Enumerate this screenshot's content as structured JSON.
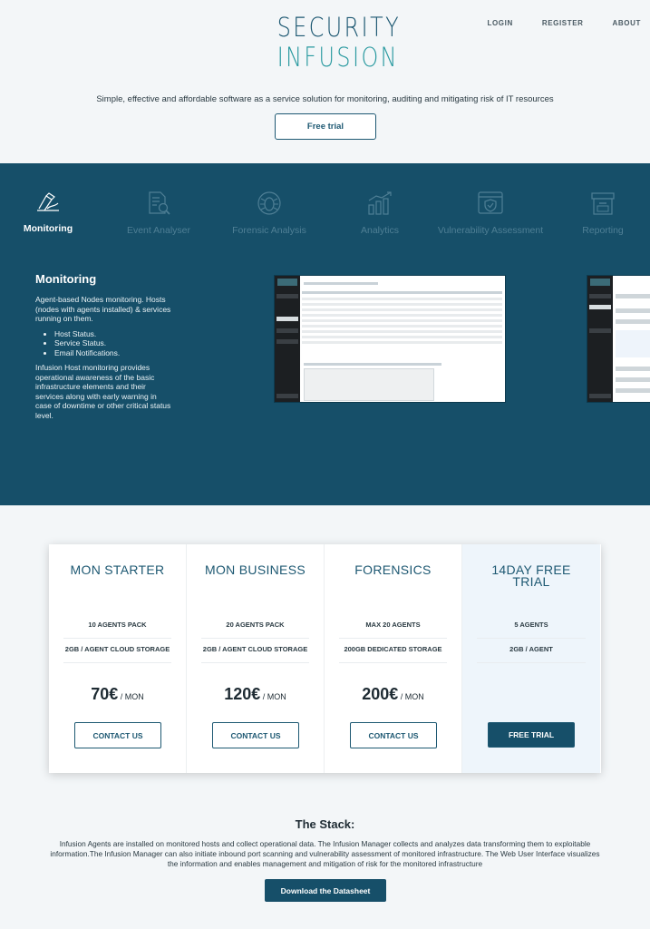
{
  "brand": {
    "line1": "SECURITY",
    "line2": "INFUSION",
    "color_dark": "#1d5872",
    "color_teal": "#2a9aa0"
  },
  "nav": {
    "login": "LOGIN",
    "register": "REGISTER",
    "about": "ABOUT"
  },
  "hero": {
    "tagline": "Simple, effective and affordable software as a service solution for monitoring, auditing and mitigating risk of IT resources",
    "cta": "Free trial"
  },
  "features": {
    "band_color": "#164f69",
    "tabs": [
      {
        "label": "Monitoring",
        "icon": "monitoring-pen-icon",
        "active": true
      },
      {
        "label": "Event Analyser",
        "icon": "document-search-icon",
        "active": false
      },
      {
        "label": "Forensic Analysis",
        "icon": "bug-icon",
        "active": false
      },
      {
        "label": "Analytics",
        "icon": "bar-chart-icon",
        "active": false
      },
      {
        "label": "Vulnerability Assessment",
        "icon": "shield-window-icon",
        "active": false
      },
      {
        "label": "Reporting",
        "icon": "archive-box-icon",
        "active": false
      }
    ],
    "detail": {
      "title": "Monitoring",
      "intro": "Agent-based Nodes monitoring. Hosts (nodes with agents installed) & services running on them.",
      "bullets": [
        "Host Status.",
        "Service Status.",
        "Email Notifications."
      ],
      "outro": "Infusion Host monitoring provides operational awareness of the basic infrastructure elements and their services along with early warning in case of downtime or other critical status level."
    }
  },
  "pricing": {
    "plans": [
      {
        "name": "MON STARTER",
        "feature1": "10 AGENTS PACK",
        "feature2": "2GB / AGENT CLOUD STORAGE",
        "price": "70€",
        "period": " / MON",
        "cta": "CONTACT US"
      },
      {
        "name": "MON BUSINESS",
        "feature1": "20 AGENTS PACK",
        "feature2": "2GB / AGENT CLOUD STORAGE",
        "price": "120€",
        "period": " / MON",
        "cta": "CONTACT US"
      },
      {
        "name": "FORENSICS",
        "feature1": "MAX 20 AGENTS",
        "feature2": "200GB DEDICATED STORAGE",
        "price": "200€",
        "period": " / MON",
        "cta": "CONTACT US"
      },
      {
        "name": "14DAY FREE TRIAL",
        "feature1": "5 AGENTS",
        "feature2": "2GB / AGENT",
        "price": "",
        "period": "",
        "cta": "FREE TRIAL"
      }
    ]
  },
  "stack": {
    "title": "The Stack:",
    "text": "Infusion Agents are installed on monitored hosts and collect operational data. The Infusion Manager collects and analyzes data transforming them to exploitable information.The Infusion Manager can also initiate inbound port scanning and vulnerability assessment of monitored infrastructure. The Web User Interface visualizes the information and enables management and mitigation of risk for the monitored infrastructure",
    "cta": "Download the Datasheet"
  }
}
